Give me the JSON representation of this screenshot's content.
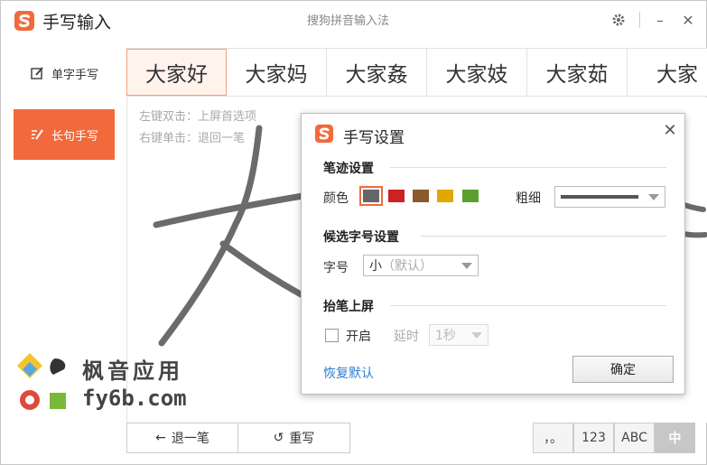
{
  "app": {
    "title": "手写输入",
    "center_title": "搜狗拼音输入法",
    "settings_icon": "gear-icon",
    "minimize_glyph": "–",
    "close_glyph": "✕",
    "brand_color": "#f26a3b"
  },
  "sidebar": {
    "items": [
      {
        "label": "单字手写",
        "icon": "single-char-edit-icon",
        "active": false
      },
      {
        "label": "长句手写",
        "icon": "sentence-write-icon",
        "active": true
      }
    ]
  },
  "candidates": [
    "大家好",
    "大家妈",
    "大家姦",
    "大家妓",
    "大家茹",
    "大家"
  ],
  "hints": {
    "left_dbl": "左键双击：上屏首选项",
    "right_click": "右键单击：退回一笔"
  },
  "bottom": {
    "undo_label": "退一笔",
    "undo_glyph": "←",
    "rewrite_label": "重写",
    "rewrite_glyph": "↺",
    "modes": [
      {
        "label": "，。",
        "active": false
      },
      {
        "label": "123",
        "active": false
      },
      {
        "label": "ABC",
        "active": false
      },
      {
        "label": "中",
        "active": true
      }
    ]
  },
  "watermark": {
    "line1": "枫音应用",
    "line2": "fy6b.com"
  },
  "dialog": {
    "title": "手写设置",
    "close_glyph": "✕",
    "stroke_section": "笔迹设置",
    "color_label": "颜色",
    "colors": [
      "#666666",
      "#cc2222",
      "#8a5a2b",
      "#e0a800",
      "#5aa02c"
    ],
    "selected_color_index": 0,
    "thickness_label": "粗细",
    "candidate_section": "候选字号设置",
    "size_label": "字号",
    "size_value": "小",
    "size_default": "（默认）",
    "lift_section": "抬笔上屏",
    "enable_label": "开启",
    "enable_checked": false,
    "delay_label": "延时",
    "delay_value": "1秒",
    "restore_label": "恢复默认",
    "ok_label": "确定"
  }
}
